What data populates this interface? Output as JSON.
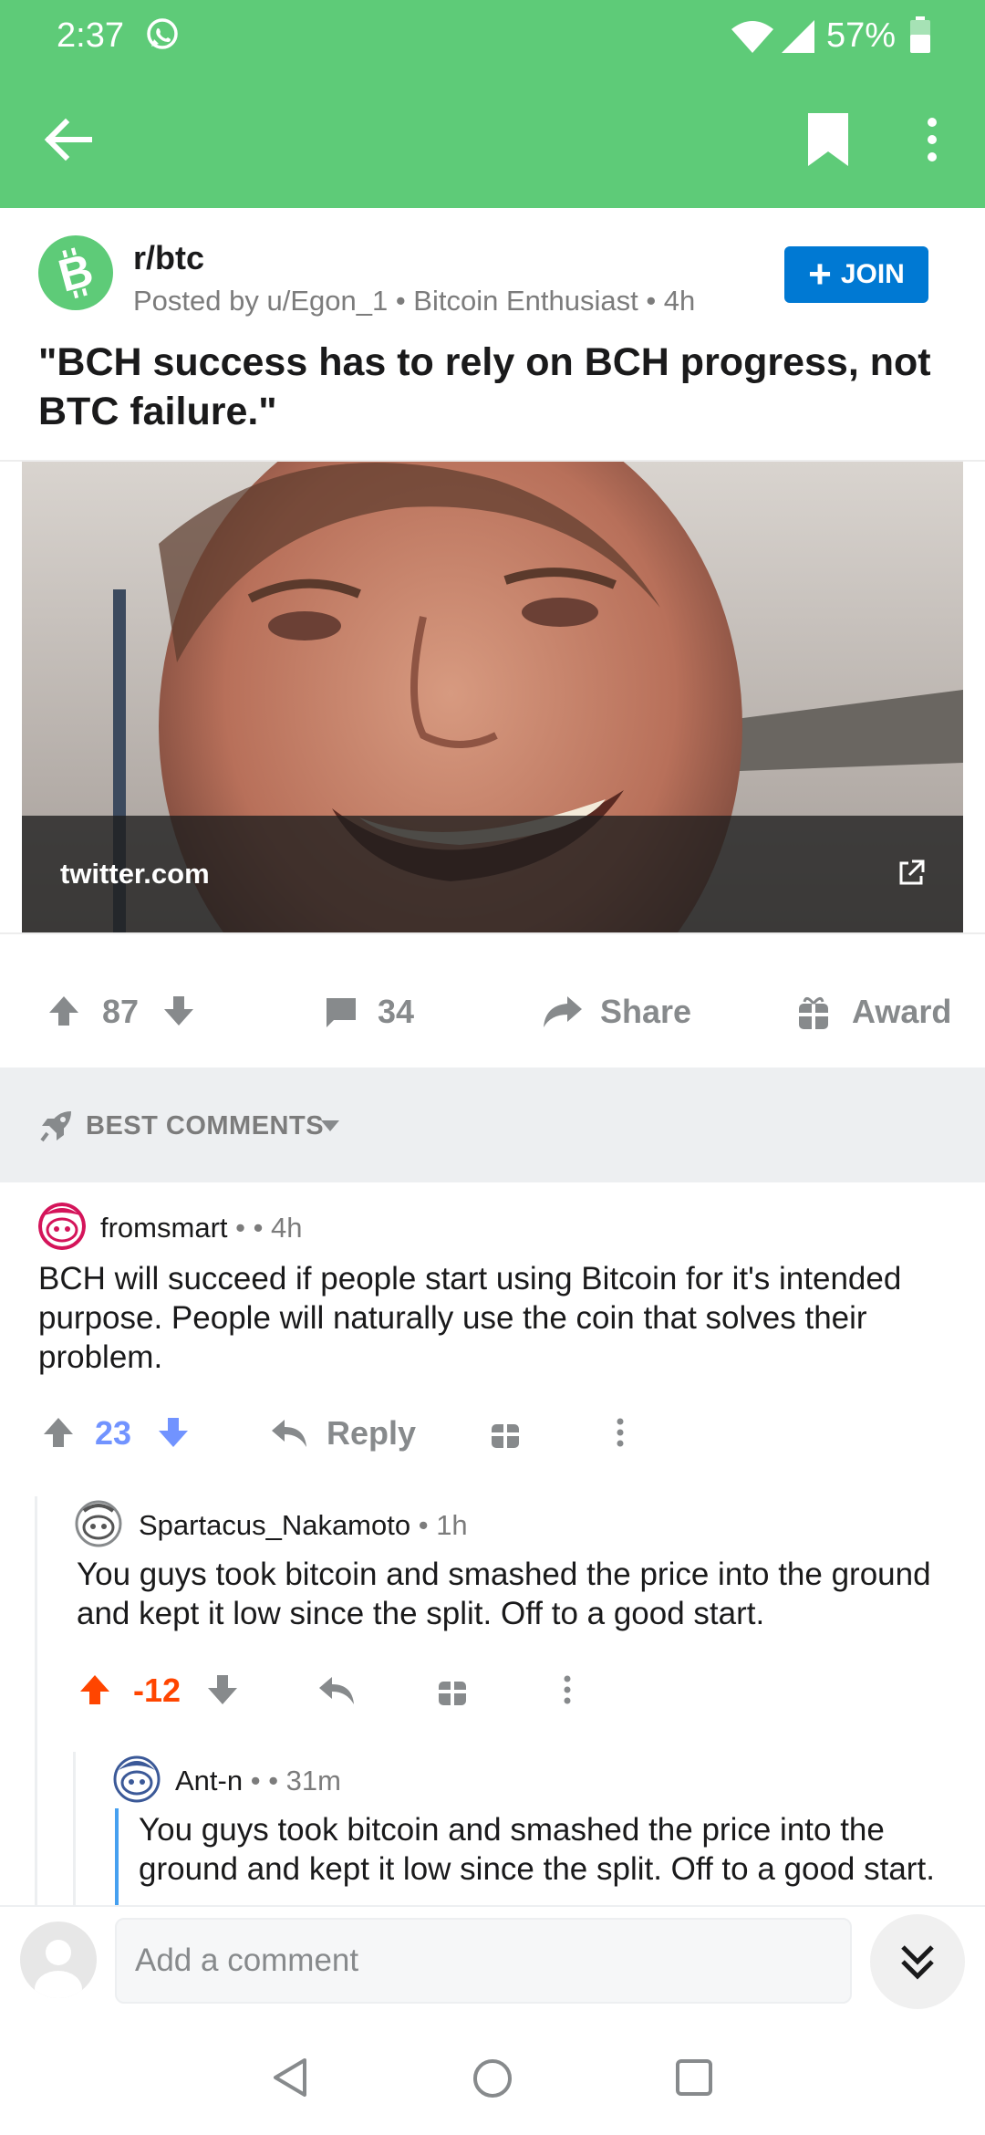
{
  "status_bar": {
    "time": "2:37",
    "battery": "57%"
  },
  "post": {
    "subreddit": "r/btc",
    "meta": "Posted by u/Egon_1 • Bitcoin Enthusiast • 4h",
    "join_label": "JOIN",
    "title": "\"BCH success has to rely on BCH progress, not BTC failure.\"",
    "link_domain": "twitter.com",
    "score": "87",
    "comment_count": "34",
    "share_label": "Share",
    "award_label": "Award"
  },
  "sort": {
    "label": "BEST COMMENTS"
  },
  "comments": [
    {
      "user": "fromsmart",
      "time": " •  • 4h",
      "body": "BCH will succeed if people start using Bitcoin for it's intended purpose. People will naturally use the coin that solves their problem.",
      "score": "23",
      "reply_label": "Reply"
    },
    {
      "user": "Spartacus_Nakamoto",
      "time": " • 1h",
      "body": "You guys took bitcoin and smashed the price into the ground and kept it low since the split. Off to a good start.",
      "score": "-12"
    },
    {
      "user": "Ant-n",
      "time": " •  • 31m",
      "body": "You guys took bitcoin and smashed the price into the ground and kept it low since the split. Off to a good start."
    }
  ],
  "composer": {
    "placeholder": "Add a comment"
  },
  "colors": {
    "app_bar": "#5ecb78",
    "join": "#0079d3",
    "upvoted": "#ff4500",
    "downvoted": "#7193ff",
    "quote": "#46a0f0"
  },
  "icons": [
    "whatsapp-icon",
    "wifi-icon",
    "signal-icon",
    "battery-icon",
    "back-arrow-icon",
    "bookmark-icon",
    "more-vertical-icon",
    "bitcoin-icon",
    "external-link-icon",
    "upvote-icon",
    "downvote-icon",
    "comment-icon",
    "share-icon",
    "award-icon",
    "rocket-icon",
    "reply-icon",
    "double-chevron-down-icon"
  ]
}
